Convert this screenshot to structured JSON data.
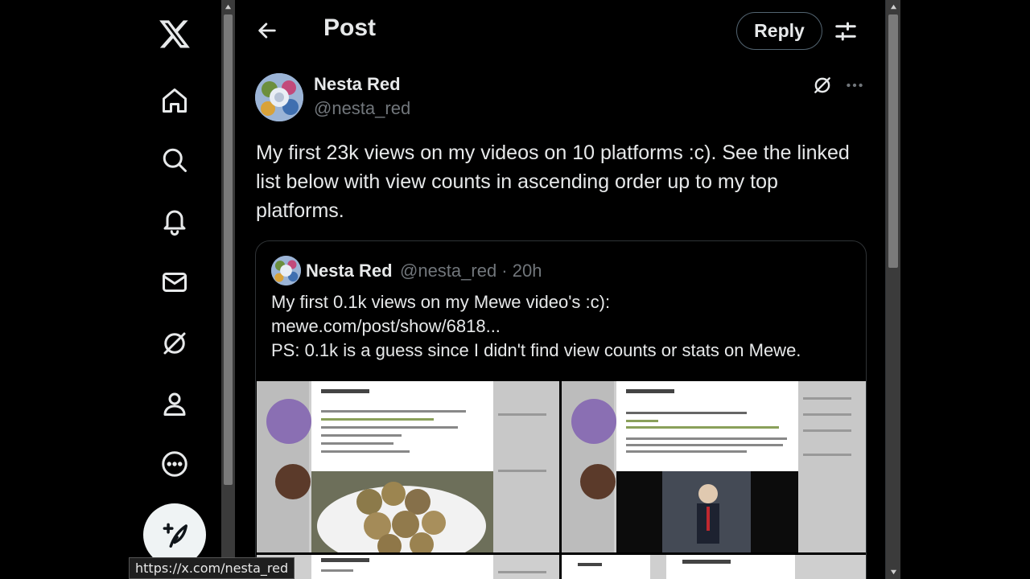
{
  "nav": {
    "items": [
      {
        "name": "x-logo-icon"
      },
      {
        "name": "home-icon"
      },
      {
        "name": "search-icon"
      },
      {
        "name": "notifications-icon"
      },
      {
        "name": "messages-icon"
      },
      {
        "name": "grok-icon"
      },
      {
        "name": "profile-icon"
      },
      {
        "name": "more-icon"
      }
    ],
    "compose_icon": "compose-post-icon"
  },
  "header": {
    "title": "Post",
    "reply_label": "Reply"
  },
  "tweet": {
    "author_name": "Nesta Red",
    "author_handle": "@nesta_red",
    "text": "My first 23k views on my videos on 10 platforms :c). See the linked list below with view counts in ascending order up to my top platforms."
  },
  "quote": {
    "author_name": "Nesta Red",
    "handle_time": "@nesta_red · 20h",
    "lines": [
      "My first 0.1k views on my Mewe video's :c):",
      "mewe.com/post/show/6818...",
      "PS: 0.1k is a guess since I didn't find view counts or stats on Mewe."
    ]
  },
  "status_bar": {
    "url": "https://x.com/nesta_red"
  },
  "colors": {
    "background": "#000000",
    "text": "#e7e9ea",
    "muted": "#71767b",
    "border": "#2f3336"
  }
}
